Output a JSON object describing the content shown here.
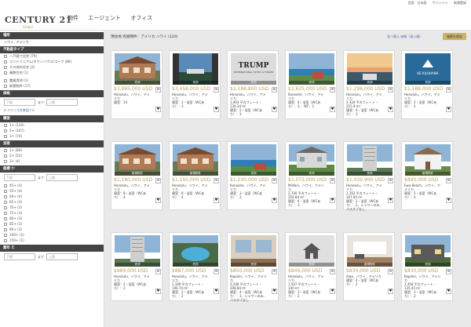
{
  "topbar": {
    "lang": "言語：日本語",
    "signin": "サインイン",
    "register": "新規登録"
  },
  "logo": {
    "brand": "CENTURY 21",
    "sub": "Global"
  },
  "nav": [
    "物件",
    "エージェント",
    "オフィス"
  ],
  "sidebar": {
    "location_head": "場所",
    "location_value": "ハワイ, アメリカ",
    "type_head": "不動産タイプ",
    "types": [
      "一戸建て住宅 (79)",
      "コンドミニアム/タウンハウス/コープ (86)",
      "その他の住宅 (2)",
      "複数住宅 (1)"
    ],
    "types2": [
      "農業用地 (1)",
      "新築物件 (17)"
    ],
    "price_head": "価格",
    "price_min": "下限",
    "price_max": "上限",
    "range_sep": "まで",
    "currency": "$ アメリカ合衆国ドル",
    "bed_head": "寝室",
    "beds": [
      "1+ (120)",
      "2+ (107)",
      "3+ (74)"
    ],
    "bath_head": "浴室",
    "baths": [
      "1+ (80)",
      "2+ (53)",
      "3+ (4)"
    ],
    "size_head": "面積",
    "size_unit": "ft²",
    "size_min": "下限",
    "size_max": "上限",
    "ages": [
      "45+ (4)",
      "55+ (4)",
      "60+ (4)",
      "65+ (3)",
      "70+ (3)",
      "75+ (3)",
      "80+ (3)",
      "85+ (3)",
      "90+ (3)",
      "100+ (2)",
      "150+ (1)"
    ],
    "year_head": "築年",
    "year_unit": "年",
    "year_min": "下限",
    "year_max": "上限"
  },
  "results": {
    "label": "現住地",
    "summary": "売買物件：アメリカ ハワイ (120)"
  },
  "sort": {
    "label": "並べ替え",
    "value": "価格（高い順）"
  },
  "save_search": "検索を保存",
  "badges": {
    "sale": "売却",
    "new": "新規物件"
  },
  "listings": [
    {
      "price": "$3,995,000 USD",
      "l1": "Honolulu、ハワイ、アメリカ",
      "l2": "寝室：14",
      "l3": "",
      "scene": "house",
      "badge": "sale"
    },
    {
      "price": "$3,458,000 USD",
      "l1": "Honolulu、ハワイ、アメリカ",
      "l2": "寝室：2・浴室（WCあり）：3",
      "l3": "",
      "scene": "view",
      "badge": "sale"
    },
    {
      "price": "$2,188,800 USD",
      "l1": "Honolulu、ハワイ、アメリカ",
      "l2": "1,403 平方フィート・130.34 m²",
      "l3": "寝室：2・浴室（WCあり）：3",
      "scene": "trump",
      "badge": "sale"
    },
    {
      "price": "$1,625,000 USD",
      "l1": "Kaneohe、ハワイ、アメリカ",
      "l2": "寝室：4・浴室（WCあり）：3、 WC：1",
      "l3": "",
      "scene": "coast",
      "badge": "sale"
    },
    {
      "price": "$1,298,000 USD",
      "l1": "Honolulu、ハワイ、アメリカ",
      "l2": "2,324 平方フィート・215.9 m²",
      "l3": "寝室：4・浴室（WCあり）：3",
      "scene": "sunset",
      "badge": "sale"
    },
    {
      "price": "$1,188,000 USD",
      "l1": "Honolulu、ハワイ、アメリカ",
      "l2": "寝室：2・浴室（WCあり）：2",
      "l3": "",
      "scene": "logo",
      "badge": "sale"
    },
    {
      "price": "$1,180,000 USD",
      "l1": "Honolulu、ハワイ、アメリカ",
      "l2": "寝室：8・浴室（WCあり）：4",
      "l3": "",
      "scene": "house",
      "badge": "new"
    },
    {
      "price": "$1,150,000 USD",
      "l1": "Honolulu、ハワイ、アメリカ",
      "l2": "寝室：8・浴室（WCあり）：4",
      "l3": "",
      "scene": "house",
      "badge": "new"
    },
    {
      "price": "$1,100,000 USD",
      "l1": "Kaneohe、ハワイ、アメリカ",
      "l2": "寝室：3・浴室（WCあり）：2",
      "l3": "",
      "scene": "coast",
      "badge": "sale"
    },
    {
      "price": "$1,072,000 USD",
      "l1": "Mililani、ハワイ、アメリカ",
      "l2": "2,700 平方フィート・250.84 m²",
      "l3": "寝室：4・浴室（WCあり）：3",
      "scene": "villa",
      "badge": "sale"
    },
    {
      "price": "$1,029,900 USD",
      "l1": "Honolulu、ハワイ、アメリカ",
      "l2": "1,162 平方フィート・107.95 m²",
      "l3": "寝室：2・浴室（WCあり）：2、シャワーのみ、バスタブなし",
      "scene": "tower",
      "badge": "sale"
    },
    {
      "price": "$890,000 USD",
      "l1": "Ewa Beach、ハワイ、アメリカ",
      "l2": "寝室：5・浴室（WCあり）：4",
      "l3": "",
      "scene": "home2",
      "badge": "new"
    },
    {
      "price": "$889,000 USD",
      "l1": "Honolulu、ハワイ、アメリカ",
      "l2": "寝室：2・浴室（WCあり）：2",
      "l3": "",
      "scene": "tower",
      "badge": "sale"
    },
    {
      "price": "$887,000 USD",
      "l1": "Honolulu、ハワイ、アメリカ",
      "l2": "1,149 平方フィート・106.74 m²",
      "l3": "寝室：2・浴室（WCあり）：2",
      "scene": "pool",
      "badge": "sale"
    },
    {
      "price": "$850,000 USD",
      "l1": "Kapolei、ハワイ、アメリカ",
      "l2": "2,248 平方フィート・208.84 m²",
      "l3": "寝室：4・浴室（WCあり）：3、シャワーのみ、バスタブなし",
      "scene": "interior",
      "badge": "sale"
    },
    {
      "price": "$849,000 USD",
      "l1": "Honolulu、ハワイ、アメリカ",
      "l2": "1,507 平方フィート・140 m²",
      "l3": "寝室：3・浴室（WCあり）：2",
      "scene": "placeholder",
      "badge": "sale"
    },
    {
      "price": "$830,000 USD",
      "l1": "Aiea、ハワイ、アメリカ",
      "l2": "寝室：4・浴室（WCあり）：2",
      "l3": "",
      "scene": "interior2",
      "badge": "new"
    },
    {
      "price": "$830,000 USD",
      "l1": "Kapolei、ハワイ、アメリカ",
      "l2": "1,458 平方フィート・135.45 m²",
      "l3": "寝室：3・浴室（WCあり）：2",
      "scene": "home3",
      "badge": "sale"
    }
  ]
}
